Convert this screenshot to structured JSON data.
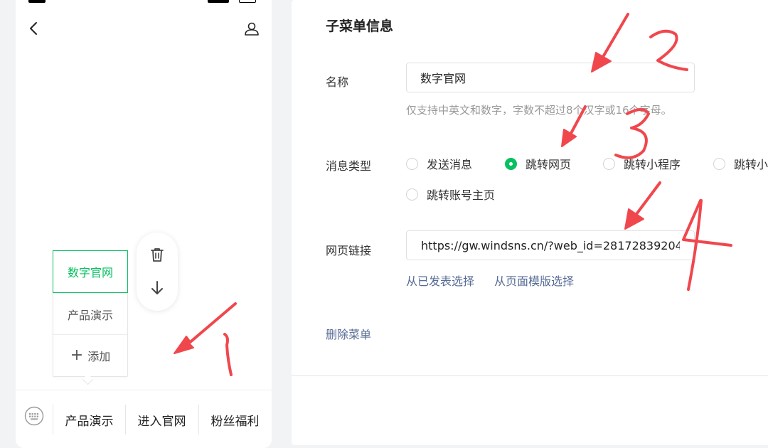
{
  "phone": {
    "submenu": {
      "items": [
        "数字官网",
        "产品演示"
      ],
      "add_label": "添加"
    },
    "menubar": {
      "items": [
        "产品演示",
        "进入官网",
        "粉丝福利"
      ]
    }
  },
  "editor": {
    "title": "子菜单信息",
    "name": {
      "label": "名称",
      "value": "数字官网",
      "hint": "仅支持中英文和数字，字数不超过8个汉字或16个字母。"
    },
    "message_type": {
      "label": "消息类型",
      "options": [
        "发送消息",
        "跳转网页",
        "跳转小程序",
        "跳转小",
        "跳转账号主页"
      ],
      "selected": "跳转网页"
    },
    "url": {
      "label": "网页链接",
      "value": "https://gw.windsns.cn/?web_id=28172839204",
      "links": [
        "从已发表选择",
        "从页面模版选择"
      ]
    },
    "delete_label": "删除菜单"
  },
  "annotations": {
    "numbers": [
      "1",
      "2",
      "3",
      "4"
    ],
    "color": "#f0474d"
  },
  "colors": {
    "accent": "#07c160",
    "link": "#576b95",
    "hint": "#999999"
  }
}
